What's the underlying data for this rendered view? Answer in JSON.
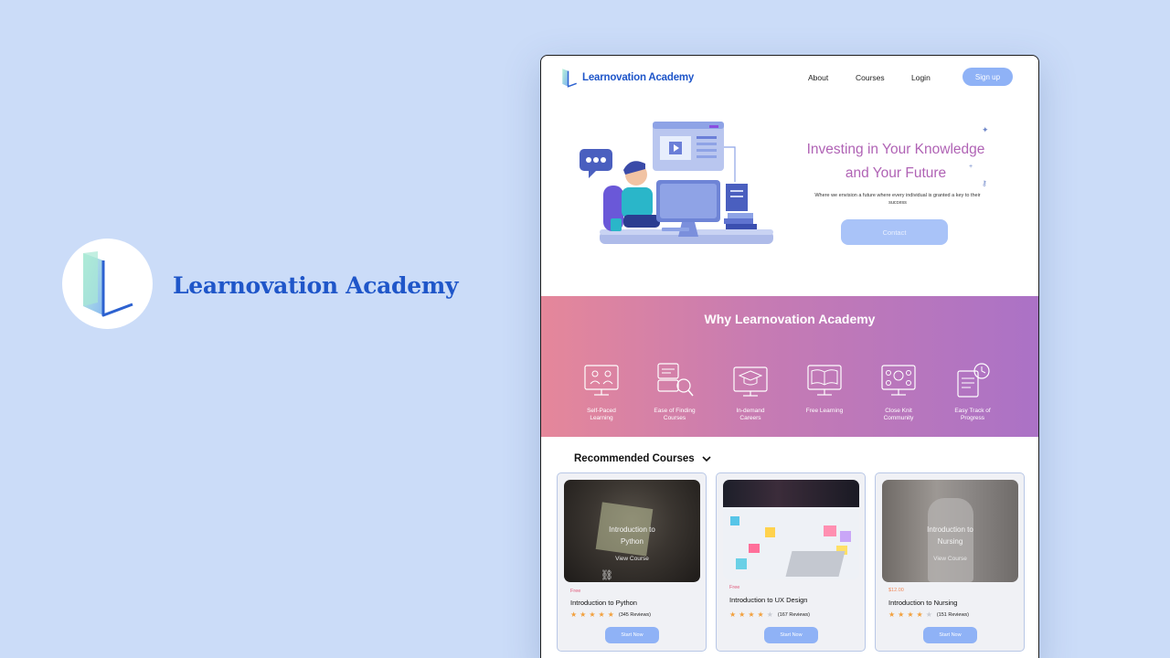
{
  "brand": {
    "name": "Learnovation Academy",
    "color": "#1f56c9"
  },
  "nav": {
    "logo_text": "Learnovation Academy",
    "links": [
      "About",
      "Courses",
      "Login"
    ],
    "signup_label": "Sign up"
  },
  "hero": {
    "title_line1": "Investing in Your Knowledge",
    "title_line2": "and Your Future",
    "subtitle": "Where we envision a future where every individual is granted a key to their success",
    "contact_label": "Contact"
  },
  "why": {
    "title": "Why Learnovation Academy",
    "features": [
      {
        "label": "Self-Paced\nLearning",
        "icon": "monitor-people-icon"
      },
      {
        "label": "Ease of Finding\nCourses",
        "icon": "search-course-icon"
      },
      {
        "label": "In-demand\nCareers",
        "icon": "graduation-monitor-icon"
      },
      {
        "label": "Free Learning",
        "icon": "open-book-icon"
      },
      {
        "label": "Close Knit\nCommunity",
        "icon": "community-icon"
      },
      {
        "label": "Easy Track of\nProgress",
        "icon": "progress-clock-icon"
      }
    ]
  },
  "recommended": {
    "heading": "Recommended Courses",
    "courses": [
      {
        "overlay_title": "Introduction to\nPython",
        "overlay_link": "View Course",
        "price": "Free",
        "name": "Introduction to Python",
        "rating": 5,
        "reviews": "(345 Reviews)",
        "button": "Start Now"
      },
      {
        "overlay_title": "",
        "overlay_link": "",
        "price": "Free",
        "name": "Introduction to UX Design",
        "rating": 4,
        "reviews": "(167 Reviews)",
        "button": "Start Now"
      },
      {
        "overlay_title": "Introduction to\nNursing",
        "overlay_link": "View Course",
        "price": "$12.00",
        "name": "Introduction to Nursing",
        "rating": 4,
        "reviews": "(151 Reviews)",
        "button": "Start Now"
      }
    ]
  },
  "colors": {
    "background": "#cbdcf8",
    "accent": "#8fb2f6",
    "hero_title": "#b063b5",
    "star": "#f2a03d"
  }
}
